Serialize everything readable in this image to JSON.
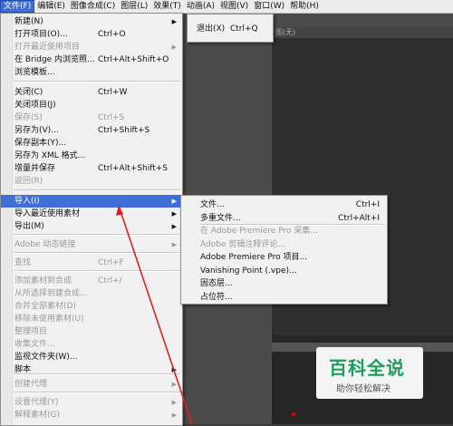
{
  "menubar": {
    "items": [
      "文件(F)",
      "编辑(E)",
      "图像合成(C)",
      "图层(L)",
      "效果(T)",
      "动画(A)",
      "视图(V)",
      "窗口(W)",
      "帮助(H)"
    ]
  },
  "background": {
    "panel_title": "图(无)"
  },
  "file_menu": {
    "items": [
      {
        "label": "新建(N)",
        "shortcut": "",
        "submenu": true,
        "disabled": false
      },
      {
        "label": "打开项目(O)...",
        "shortcut": "Ctrl+O",
        "submenu": false,
        "disabled": false
      },
      {
        "label": "打开最近使用项目",
        "shortcut": "",
        "submenu": true,
        "disabled": true
      },
      {
        "label": "在 Bridge 内浏览照...",
        "shortcut": "Ctrl+Alt+Shift+O",
        "submenu": false,
        "disabled": false
      },
      {
        "label": "浏览模板...",
        "shortcut": "",
        "submenu": false,
        "disabled": false
      },
      {
        "label": "关闭(C)",
        "shortcut": "Ctrl+W",
        "submenu": false,
        "disabled": false
      },
      {
        "label": "关闭项目(J)",
        "shortcut": "",
        "submenu": false,
        "disabled": false
      },
      {
        "label": "保存(S)",
        "shortcut": "Ctrl+S",
        "submenu": false,
        "disabled": true
      },
      {
        "label": "另存为(V)...",
        "shortcut": "Ctrl+Shift+S",
        "submenu": false,
        "disabled": false
      },
      {
        "label": "保存副本(Y)...",
        "shortcut": "",
        "submenu": false,
        "disabled": false
      },
      {
        "label": "另存为 XML 格式...",
        "shortcut": "",
        "submenu": false,
        "disabled": false
      },
      {
        "label": "增量并保存",
        "shortcut": "Ctrl+Alt+Shift+S",
        "submenu": false,
        "disabled": false
      },
      {
        "label": "返回(R)",
        "shortcut": "",
        "submenu": false,
        "disabled": true
      },
      {
        "label": "导入(I)",
        "shortcut": "",
        "submenu": true,
        "disabled": false,
        "highlighted": true
      },
      {
        "label": "导入最近使用素材",
        "shortcut": "",
        "submenu": true,
        "disabled": false
      },
      {
        "label": "导出(M)",
        "shortcut": "",
        "submenu": true,
        "disabled": false
      },
      {
        "label": "Adobe 动态链接",
        "shortcut": "",
        "submenu": true,
        "disabled": true
      },
      {
        "label": "查找",
        "shortcut": "Ctrl+F",
        "submenu": false,
        "disabled": true
      },
      {
        "label": "添加素材到合成",
        "shortcut": "Ctrl+/",
        "submenu": false,
        "disabled": true
      },
      {
        "label": "从所选择到建合成...",
        "shortcut": "",
        "submenu": false,
        "disabled": true
      },
      {
        "label": "合并全部素材(D)",
        "shortcut": "",
        "submenu": false,
        "disabled": true
      },
      {
        "label": "移除未使用素材(U)",
        "shortcut": "",
        "submenu": false,
        "disabled": true
      },
      {
        "label": "整理项目",
        "shortcut": "",
        "submenu": false,
        "disabled": true
      },
      {
        "label": "收集文件...",
        "shortcut": "",
        "submenu": false,
        "disabled": true
      },
      {
        "label": "监视文件夹(W)...",
        "shortcut": "",
        "submenu": false,
        "disabled": false
      },
      {
        "label": "脚本",
        "shortcut": "",
        "submenu": true,
        "disabled": false
      },
      {
        "label": "创建代理",
        "shortcut": "",
        "submenu": true,
        "disabled": true
      },
      {
        "label": "设置代理(Y)",
        "shortcut": "",
        "submenu": true,
        "disabled": true
      },
      {
        "label": "解释素材(G)",
        "shortcut": "",
        "submenu": true,
        "disabled": true
      }
    ]
  },
  "exit_menu": {
    "label": "退出(X)",
    "shortcut": "Ctrl+Q"
  },
  "import_menu": {
    "items": [
      {
        "label": "文件...",
        "shortcut": "Ctrl+I",
        "disabled": false
      },
      {
        "label": "多重文件...",
        "shortcut": "Ctrl+Alt+I",
        "disabled": false
      },
      {
        "label": "在 Adobe Premiere Pro 采集...",
        "shortcut": "",
        "disabled": true
      },
      {
        "label": "Adobe 剪辑注释评论...",
        "shortcut": "",
        "disabled": true
      },
      {
        "label": "Adobe Premiere Pro 项目...",
        "shortcut": "",
        "disabled": false
      },
      {
        "label": "Vanishing Point (.vpe)...",
        "shortcut": "",
        "disabled": false
      },
      {
        "label": "固态层...",
        "shortcut": "",
        "disabled": false
      },
      {
        "label": "占位符...",
        "shortcut": "",
        "disabled": false
      }
    ]
  },
  "watermark": {
    "title": "百科全说",
    "subtitle": "助你轻松解决"
  },
  "colors": {
    "highlight": "#3f6fd6",
    "annotation_arrow": "#e02020",
    "watermark_green": "#1aa05a"
  }
}
